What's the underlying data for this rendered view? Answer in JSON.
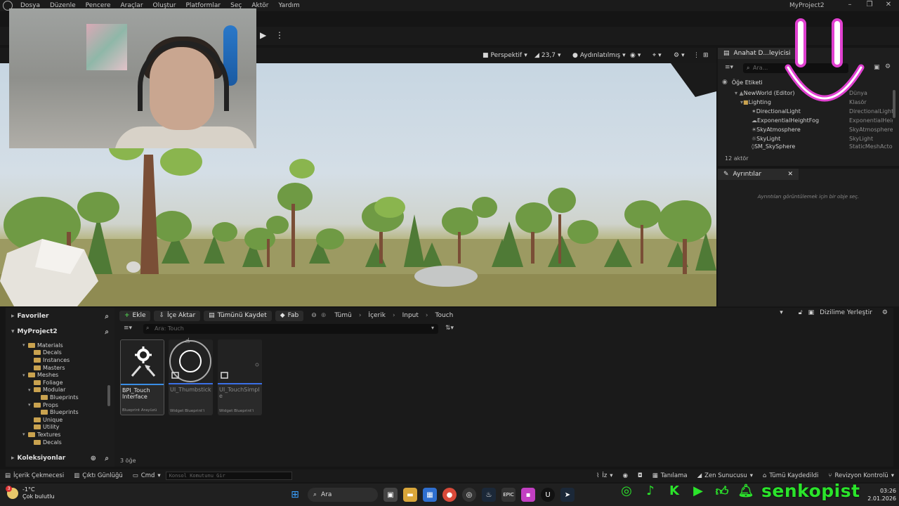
{
  "menu": {
    "items": [
      "Dosya",
      "Düzenle",
      "Pencere",
      "Araçlar",
      "Oluştur",
      "Platformlar",
      "Seç",
      "Aktör",
      "Yardım"
    ],
    "project_title": "MyProject2"
  },
  "viewport": {
    "perspective": "Perspektif",
    "fov": "23,7",
    "lighting": "Aydınlatılmış"
  },
  "outliner": {
    "tab_label": "Anahat D...leyicisi",
    "search_placeholder": "Ara...",
    "column_label": "Öğe Etiketi",
    "rows": [
      {
        "label": "NewWorld (Editor)",
        "type": "Dünya"
      },
      {
        "label": "Lighting",
        "type": "Klasör"
      },
      {
        "label": "DirectionalLight",
        "type": "DirectionalLight"
      },
      {
        "label": "ExponentialHeightFog",
        "type": "ExponentialHeightFog"
      },
      {
        "label": "SkyAtmosphere",
        "type": "SkyAtmosphere"
      },
      {
        "label": "SkyLight",
        "type": "SkyLight"
      },
      {
        "label": "SM_SkySphere",
        "type": "StaticMeshActor"
      }
    ],
    "footer": "12 aktör"
  },
  "details": {
    "tab_label": "Ayrıntılar",
    "empty_message": "Ayrıntıları görüntülemek için bir obje seç."
  },
  "content_browser": {
    "favorites": "Favoriler",
    "project": "MyProject2",
    "collections": "Koleksiyonlar",
    "tree": [
      {
        "label": "Materials",
        "depth": 1,
        "expanded": true
      },
      {
        "label": "Decals",
        "depth": 2,
        "expanded": false
      },
      {
        "label": "Instances",
        "depth": 2,
        "expanded": false
      },
      {
        "label": "Masters",
        "depth": 2,
        "expanded": false
      },
      {
        "label": "Meshes",
        "depth": 1,
        "expanded": true
      },
      {
        "label": "Foliage",
        "depth": 2,
        "expanded": false
      },
      {
        "label": "Modular",
        "depth": 2,
        "expanded": true
      },
      {
        "label": "Blueprints",
        "depth": 3,
        "expanded": false
      },
      {
        "label": "Props",
        "depth": 2,
        "expanded": true
      },
      {
        "label": "Blueprints",
        "depth": 3,
        "expanded": false
      },
      {
        "label": "Unique",
        "depth": 2,
        "expanded": false
      },
      {
        "label": "Utility",
        "depth": 2,
        "expanded": false
      },
      {
        "label": "Textures",
        "depth": 1,
        "expanded": true
      },
      {
        "label": "Decals",
        "depth": 2,
        "expanded": false
      }
    ],
    "add_label": "Ekle",
    "import_label": "İçe Aktar",
    "save_all_label": "Tümünü Kaydet",
    "fab_label": "Fab",
    "breadcrumb": [
      "Tümü",
      "İçerik",
      "Input",
      "Touch"
    ],
    "dock_label": "Dizilime Yerleştir",
    "search_placeholder": "Ara: Touch",
    "assets": [
      {
        "name": "BPI_Touch Interface",
        "kind": "Blueprint Arayüzü",
        "accent": "#3a8ee6"
      },
      {
        "name": "UI_Thumbstick",
        "kind": "Widget Blueprint'i",
        "accent": "#3a6fe6"
      },
      {
        "name": "UI_TouchSimple",
        "kind": "Widget Blueprint'i",
        "accent": "#3a6fe6"
      }
    ],
    "count": "3 öğe"
  },
  "status_bar": {
    "content_drawer": "İçerik Çekmecesi",
    "output_log": "Çıktı Günlüğü",
    "cmd": "Cmd",
    "console_placeholder": "Konsol Komutunu Gir",
    "trace": "İz",
    "diagnostics": "Tanılama",
    "zen": "Zen Sunucusu",
    "all_saved": "Tümü Kaydedildi",
    "revision": "Revizyon Kontrolü"
  },
  "taskbar": {
    "temperature": "-1°C",
    "weather": "Çok bulutlu",
    "badge": "3",
    "search": "Ara",
    "time": "03:26",
    "date": "2.01.2026"
  },
  "social": {
    "brand": "senkopist"
  },
  "colors": {
    "accent_green": "#2be42b",
    "smile_pink": "#e040d0"
  }
}
